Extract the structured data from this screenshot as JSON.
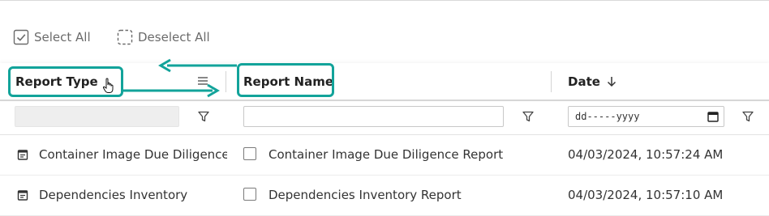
{
  "toolbar": {
    "select_all_label": "Select All",
    "deselect_all_label": "Deselect All"
  },
  "columns": {
    "report_type": "Report Type",
    "report_name": "Report Name",
    "date": "Date"
  },
  "filters": {
    "date_placeholder": "dd-----yyyy"
  },
  "rows": [
    {
      "report_type": "Container Image Due Diligence",
      "report_name": "Container Image Due Diligence Report",
      "date": "04/03/2024, 10:57:24 AM"
    },
    {
      "report_type": "Dependencies Inventory",
      "report_name": "Dependencies Inventory Report",
      "date": "04/03/2024, 10:57:10 AM"
    }
  ],
  "colors": {
    "highlight": "#12a39a",
    "header_border": "#d6d6d6"
  },
  "icons": [
    "checkbox-checked-icon",
    "checkbox-dashed-icon",
    "menu-lines-icon",
    "sort-arrow-down-icon",
    "filter-funnel-icon",
    "calendar-icon",
    "document-icon",
    "hand-cursor-icon",
    "swap-arrows-icon"
  ]
}
